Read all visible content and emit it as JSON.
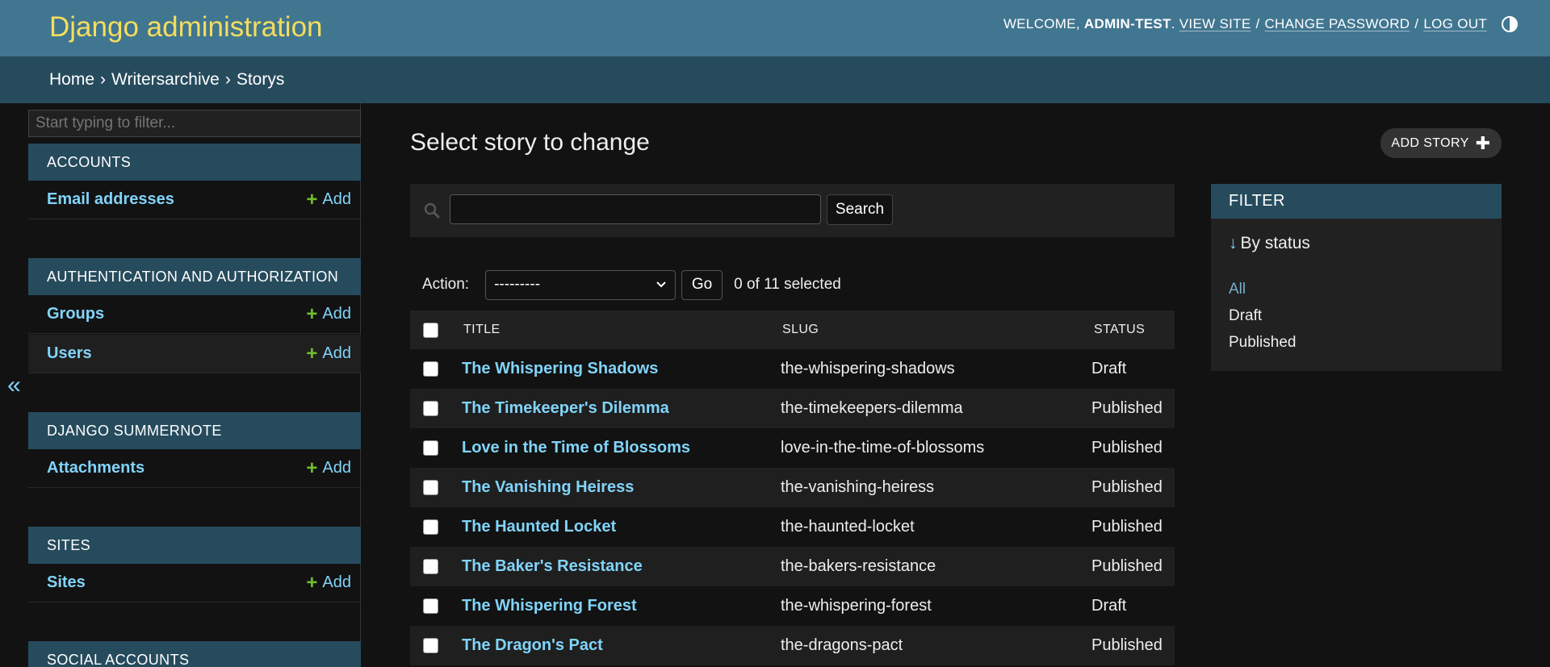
{
  "header": {
    "branding": "Django administration",
    "welcome": "WELCOME,",
    "username": "ADMIN-TEST",
    "view_site": "VIEW SITE",
    "change_password": "CHANGE PASSWORD",
    "log_out": "LOG OUT",
    "sep": "/"
  },
  "breadcrumbs": {
    "home": "Home",
    "app": "Writersarchive",
    "current": "Storys",
    "chevron": "›"
  },
  "sidebar": {
    "filter_placeholder": "Start typing to filter...",
    "toggle": "«",
    "add_label": "Add",
    "modules": [
      {
        "caption": "ACCOUNTS",
        "models": [
          "Email addresses"
        ]
      },
      {
        "caption": "AUTHENTICATION AND AUTHORIZATION",
        "models": [
          "Groups",
          "Users"
        ]
      },
      {
        "caption": "DJANGO SUMMERNOTE",
        "models": [
          "Attachments"
        ]
      },
      {
        "caption": "SITES",
        "models": [
          "Sites"
        ]
      },
      {
        "caption": "SOCIAL ACCOUNTS",
        "models": []
      }
    ]
  },
  "content": {
    "title": "Select story to change",
    "add_button": "ADD STORY",
    "search_button": "Search",
    "action_label": "Action:",
    "action_selected": "---------",
    "go_button": "Go",
    "selected_count": "0 of 11 selected",
    "columns": [
      "TITLE",
      "SLUG",
      "STATUS"
    ],
    "rows": [
      {
        "title": "The Whispering Shadows",
        "slug": "the-whispering-shadows",
        "status": "Draft"
      },
      {
        "title": "The Timekeeper's Dilemma",
        "slug": "the-timekeepers-dilemma",
        "status": "Published"
      },
      {
        "title": "Love in the Time of Blossoms",
        "slug": "love-in-the-time-of-blossoms",
        "status": "Published"
      },
      {
        "title": "The Vanishing Heiress",
        "slug": "the-vanishing-heiress",
        "status": "Published"
      },
      {
        "title": "The Haunted Locket",
        "slug": "the-haunted-locket",
        "status": "Published"
      },
      {
        "title": "The Baker's Resistance",
        "slug": "the-bakers-resistance",
        "status": "Published"
      },
      {
        "title": "The Whispering Forest",
        "slug": "the-whispering-forest",
        "status": "Draft"
      },
      {
        "title": "The Dragon's Pact",
        "slug": "the-dragons-pact",
        "status": "Published"
      }
    ]
  },
  "filter": {
    "title": "FILTER",
    "heading": "By status",
    "options": [
      "All",
      "Draft",
      "Published"
    ],
    "selected": "All"
  },
  "colors": {
    "header_bg": "#417690",
    "breadcrumb_bg": "#264b5d",
    "branding": "#f5dd5d",
    "link": "#81d4fa",
    "add_plus": "#70bf2b"
  }
}
